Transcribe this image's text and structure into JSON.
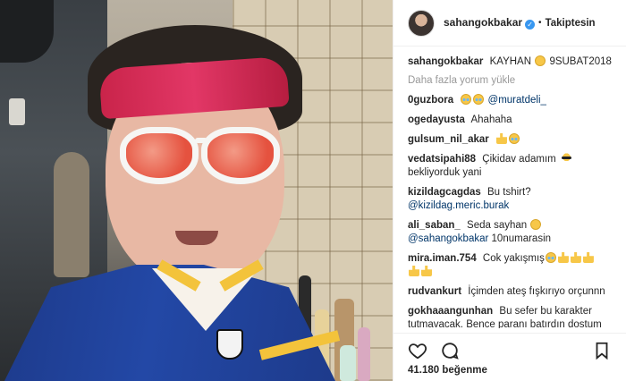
{
  "post": {
    "username": "sahangokbakar",
    "follow_status": "Takiptesin",
    "caption_text": "KAYHAN",
    "caption_tag": "9SUBAT2018",
    "load_more": "Daha fazla yorum yükle",
    "likes": "41.180 beğenme"
  },
  "comments": [
    {
      "user": "0guzbora",
      "text": "",
      "mention": "@muratdeli_"
    },
    {
      "user": "ogedayusta",
      "text": "Ahahaha",
      "mention": ""
    },
    {
      "user": "gulsum_nil_akar",
      "text": "",
      "mention": ""
    },
    {
      "user": "vedatsipahi88",
      "text": "Çikidav adamım",
      "text2": "bekliyorduk yani",
      "mention": ""
    },
    {
      "user": "kizildagcagdas",
      "text": "Bu tshirt?",
      "mention": "@kizildag.meric.burak"
    },
    {
      "user": "ali_saban_",
      "text": "Seda sayhan",
      "mention": "@sahangokbakar",
      "text2": "10numarasin"
    },
    {
      "user": "mira.iman.754",
      "text": "Cok yakışmış",
      "mention": ""
    },
    {
      "user": "rudvankurt",
      "text": "İçimden ateş fışkırıyo orçunnn",
      "mention": ""
    },
    {
      "user": "gokhaaangunhan",
      "text": "Bu sefer bu karakter",
      "text2": "tutmavacak. Bence paranı batırdın dostum",
      "mention": ""
    }
  ],
  "icons": {
    "verified": "verified-badge-icon",
    "like": "heart-icon",
    "comment": "comment-bubble-icon",
    "save": "bookmark-icon"
  },
  "colors": {
    "accent": "#3897f0",
    "mention": "#003569",
    "muted": "#999999"
  }
}
